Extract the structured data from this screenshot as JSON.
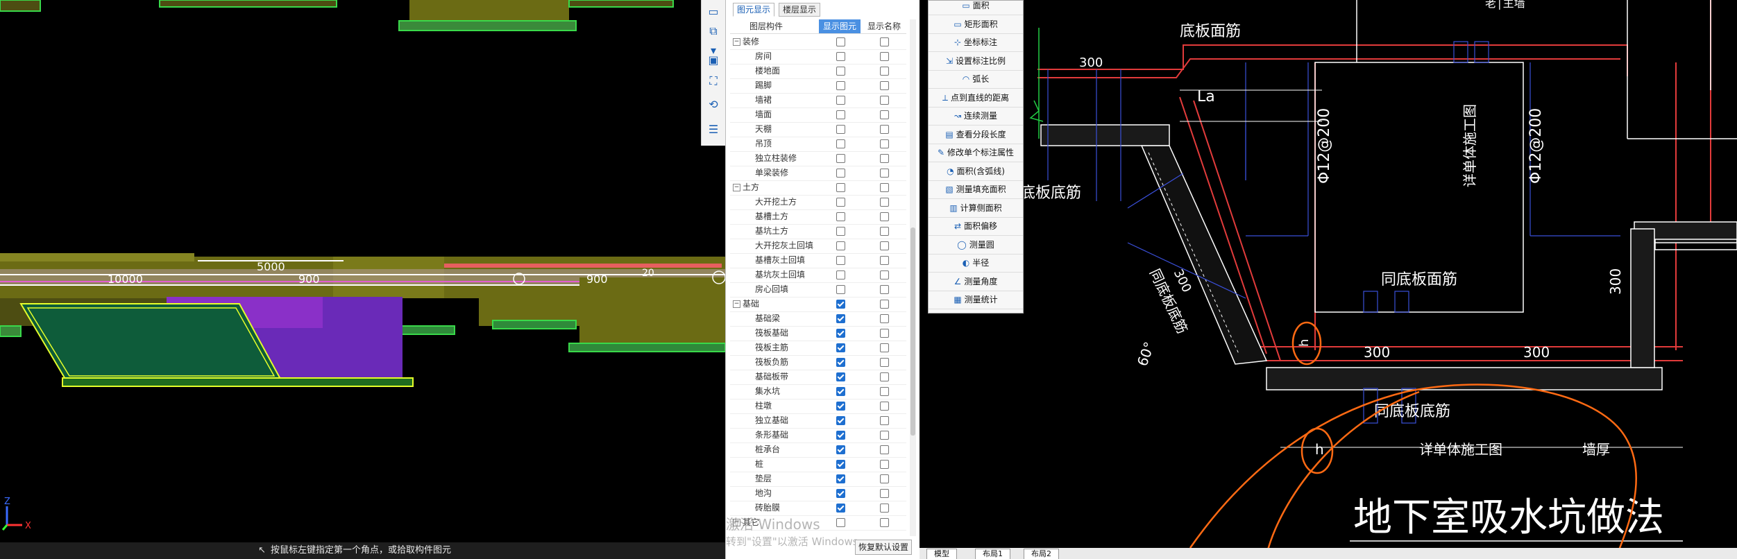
{
  "status_bar": {
    "hint": "按鼠标左键指定第一个角点，或拾取构件图元"
  },
  "view3d": {
    "dim_labels": [
      "10000",
      "5000",
      "900",
      "900",
      "20"
    ],
    "axis_x": "X",
    "axis_z": "Z"
  },
  "panel": {
    "tabs": [
      "图元显示",
      "楼层显示"
    ],
    "columns": [
      "图层构件",
      "显示图元",
      "显示名称"
    ],
    "rows": [
      {
        "name": "装修",
        "group": true,
        "show": false,
        "label": false
      },
      {
        "name": "房间",
        "group": false,
        "show": false,
        "label": false
      },
      {
        "name": "楼地面",
        "group": false,
        "show": false,
        "label": false
      },
      {
        "name": "踢脚",
        "group": false,
        "show": false,
        "label": false
      },
      {
        "name": "墙裙",
        "group": false,
        "show": false,
        "label": false
      },
      {
        "name": "墙面",
        "group": false,
        "show": false,
        "label": false
      },
      {
        "name": "天棚",
        "group": false,
        "show": false,
        "label": false
      },
      {
        "name": "吊顶",
        "group": false,
        "show": false,
        "label": false
      },
      {
        "name": "独立柱装修",
        "group": false,
        "show": false,
        "label": false
      },
      {
        "name": "单梁装修",
        "group": false,
        "show": false,
        "label": false
      },
      {
        "name": "土方",
        "group": true,
        "show": false,
        "label": false
      },
      {
        "name": "大开挖土方",
        "group": false,
        "show": false,
        "label": false
      },
      {
        "name": "基槽土方",
        "group": false,
        "show": false,
        "label": false
      },
      {
        "name": "基坑土方",
        "group": false,
        "show": false,
        "label": false
      },
      {
        "name": "大开挖灰土回填",
        "group": false,
        "show": false,
        "label": false
      },
      {
        "name": "基槽灰土回填",
        "group": false,
        "show": false,
        "label": false
      },
      {
        "name": "基坑灰土回填",
        "group": false,
        "show": false,
        "label": false
      },
      {
        "name": "房心回填",
        "group": false,
        "show": false,
        "label": false
      },
      {
        "name": "基础",
        "group": true,
        "show": true,
        "label": false
      },
      {
        "name": "基础梁",
        "group": false,
        "show": true,
        "label": false
      },
      {
        "name": "筏板基础",
        "group": false,
        "show": true,
        "label": false
      },
      {
        "name": "筏板主筋",
        "group": false,
        "show": true,
        "label": false
      },
      {
        "name": "筏板负筋",
        "group": false,
        "show": true,
        "label": false
      },
      {
        "name": "基础板带",
        "group": false,
        "show": true,
        "label": false
      },
      {
        "name": "集水坑",
        "group": false,
        "show": true,
        "label": false
      },
      {
        "name": "柱墩",
        "group": false,
        "show": true,
        "label": false
      },
      {
        "name": "独立基础",
        "group": false,
        "show": true,
        "label": false
      },
      {
        "name": "条形基础",
        "group": false,
        "show": true,
        "label": false
      },
      {
        "name": "桩承台",
        "group": false,
        "show": true,
        "label": false
      },
      {
        "name": "桩",
        "group": false,
        "show": true,
        "label": false
      },
      {
        "name": "垫层",
        "group": false,
        "show": true,
        "label": false
      },
      {
        "name": "地沟",
        "group": false,
        "show": true,
        "label": false
      },
      {
        "name": "砖胎膜",
        "group": false,
        "show": true,
        "label": false
      },
      {
        "name": "其它",
        "group": true,
        "show": false,
        "label": false
      }
    ],
    "restore_button": "恢复默认设置",
    "watermark_line1": "激活 Windows",
    "watermark_line2": "转到\"设置\"以激活 Windows。"
  },
  "measure_menu": {
    "items": [
      "面积",
      "矩形面积",
      "坐标标注",
      "设置标注比例",
      "弧长",
      "点到直线的距离",
      "连续测量",
      "查看分段长度",
      "修改单个标注属性",
      "面积(含弧线)",
      "测量填充面积",
      "计算侧面积",
      "面积偏移",
      "测量圆",
      "半径",
      "测量角度",
      "测量统计"
    ]
  },
  "cad": {
    "texts": {
      "top_right": "老│主墙",
      "bottom_slab_face": "底板面筋",
      "bottom_slab_bottom": "底板底筋",
      "la": "La",
      "rebar1": "Φ12@200",
      "rebar2": "Φ12@200",
      "detail_wall": "详单体施工图",
      "same_face": "同底板面筋",
      "same_bottom_left": "同底板底筋",
      "same_bottom": "同底板底筋",
      "dim300_a": "300",
      "dim300_b": "300",
      "dim300_c": "300",
      "dim300_d": "300",
      "dim300_e": "300",
      "angle": "60°",
      "h1": "h",
      "h2": "h",
      "detail_bottom": "详单体施工图",
      "wall_thick": "墙厚",
      "title": "地下室吸水坑做法"
    },
    "tabs": [
      "模型",
      "布局1",
      "布局2"
    ]
  }
}
